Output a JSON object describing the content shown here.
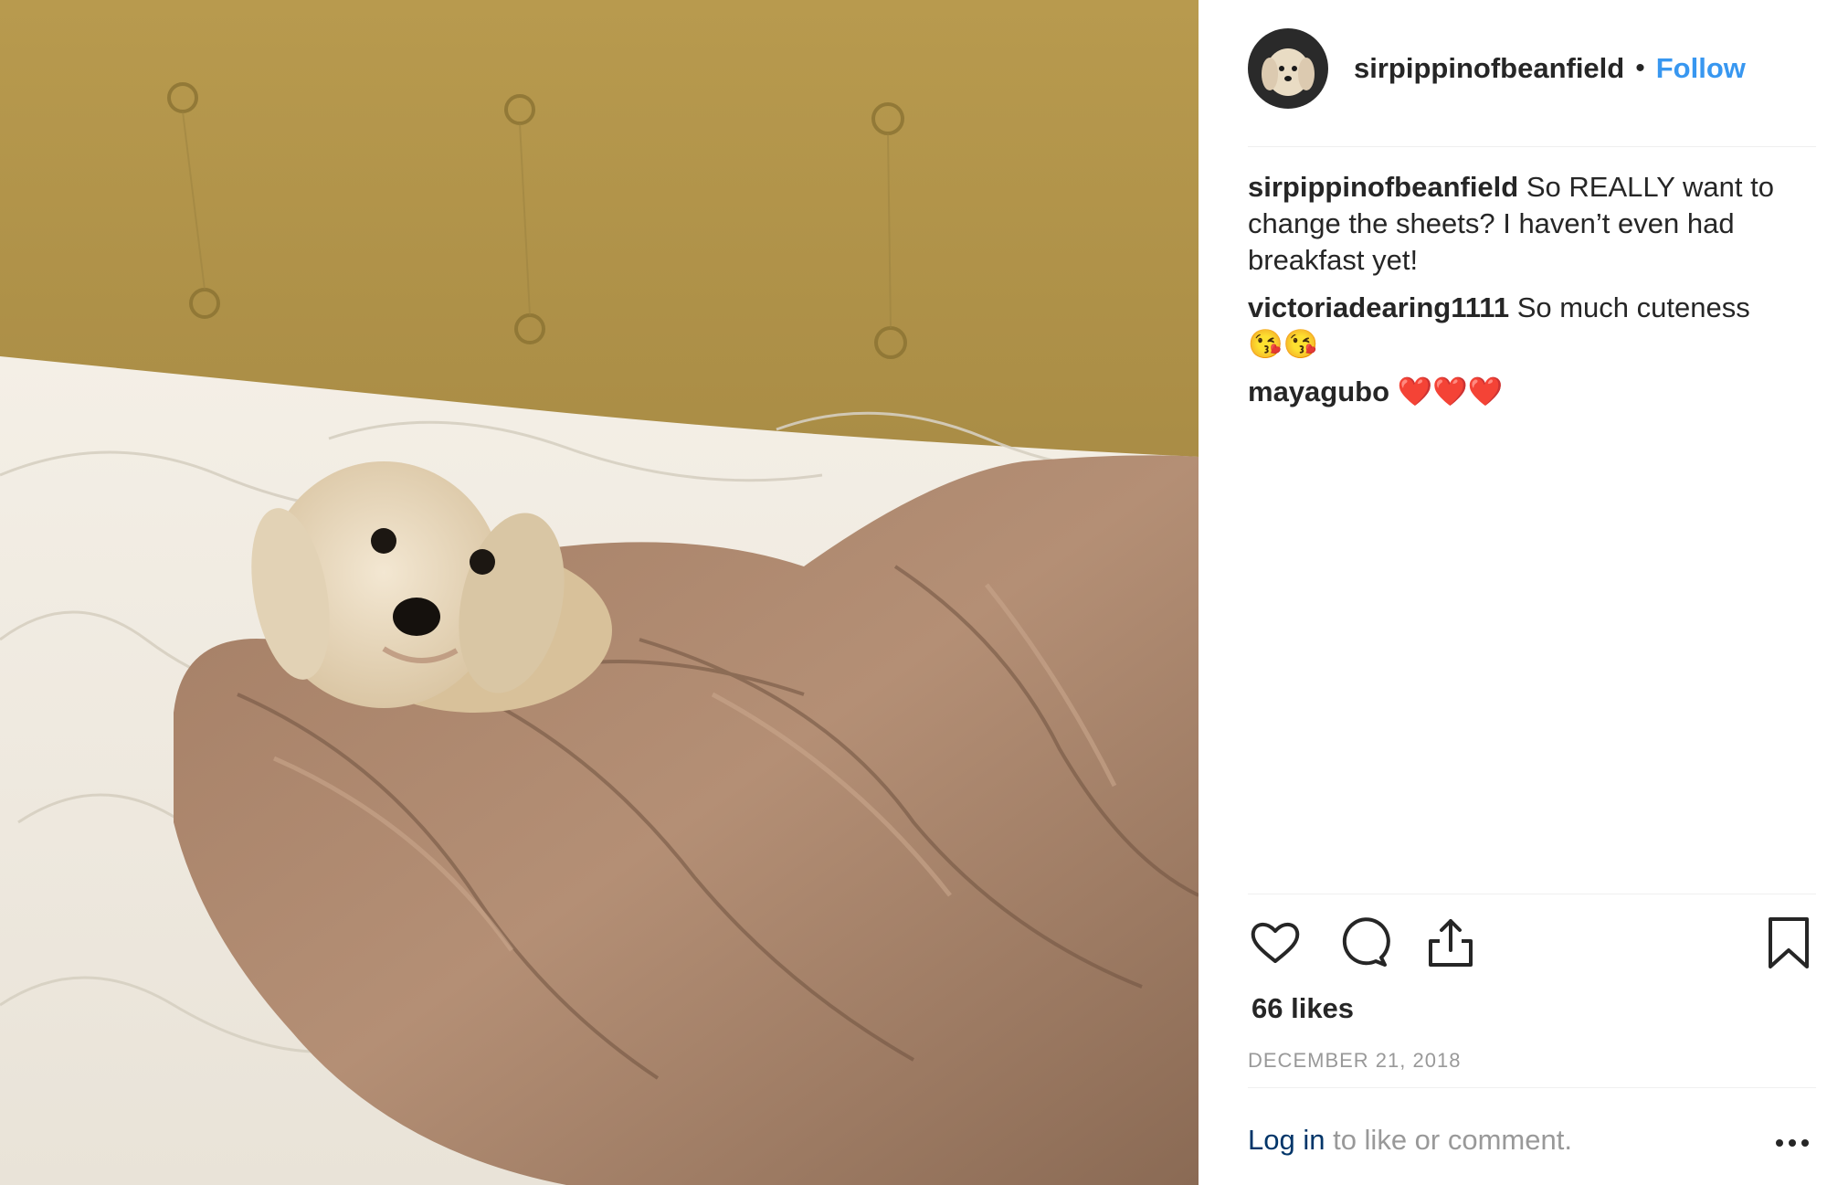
{
  "post": {
    "author": "sirpippinofbeanfield",
    "separator": "•",
    "follow_label": "Follow"
  },
  "comments": [
    {
      "user": "sirpippinofbeanfield",
      "text": "So REALLY want to change the sheets? I haven’t even had breakfast yet!"
    },
    {
      "user": "victoriadearing1111",
      "text": "So much cuteness 😘😘"
    },
    {
      "user": "mayagubo",
      "text": "❤️❤️❤️"
    }
  ],
  "actions": {
    "like_icon": "heart-icon",
    "comment_icon": "comment-icon",
    "share_icon": "share-icon",
    "save_icon": "bookmark-icon"
  },
  "likes": "66 likes",
  "date": "DECEMBER 21, 2018",
  "footer": {
    "login_link": "Log in",
    "login_rest": " to like or comment.",
    "more_icon": "more-options-icon"
  },
  "colors": {
    "accent": "#3897f0",
    "text": "#262626",
    "muted": "#999999",
    "link": "#003569"
  }
}
